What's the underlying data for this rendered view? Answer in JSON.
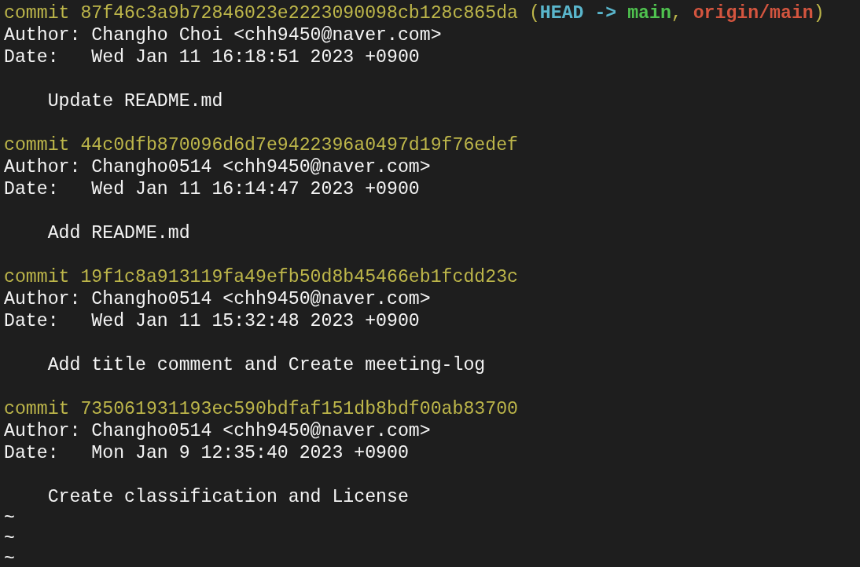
{
  "commits": [
    {
      "commit_line": "commit 87f46c3a9b72846023e2223090098cb128c865da",
      "refs": [
        {
          "kind": "punct",
          "text": "("
        },
        {
          "kind": "head",
          "text": "HEAD -> "
        },
        {
          "kind": "local",
          "text": "main"
        },
        {
          "kind": "punct",
          "text": ", "
        },
        {
          "kind": "remote",
          "text": "origin/main"
        },
        {
          "kind": "punct",
          "text": ")"
        }
      ],
      "author": "Author: Changho Choi <chh9450@naver.com>",
      "date": "Date:   Wed Jan 11 16:18:51 2023 +0900",
      "message": "Update README.md"
    },
    {
      "commit_line": "commit 44c0dfb870096d6d7e9422396a0497d19f76edef",
      "author": "Author: Changho0514 <chh9450@naver.com>",
      "date": "Date:   Wed Jan 11 16:14:47 2023 +0900",
      "message": "Add README.md"
    },
    {
      "commit_line": "commit 19f1c8a913119fa49efb50d8b45466eb1fcdd23c",
      "author": "Author: Changho0514 <chh9450@naver.com>",
      "date": "Date:   Wed Jan 11 15:32:48 2023 +0900",
      "message": "Add title comment and Create meeting-log"
    },
    {
      "commit_line": "commit 735061931193ec590bdfaf151db8bdf00ab83700",
      "author": "Author: Changho0514 <chh9450@naver.com>",
      "date": "Date:   Mon Jan 9 12:35:40 2023 +0900",
      "message": "Create classification and License"
    }
  ],
  "tildes": [
    "~",
    "~",
    "~"
  ]
}
